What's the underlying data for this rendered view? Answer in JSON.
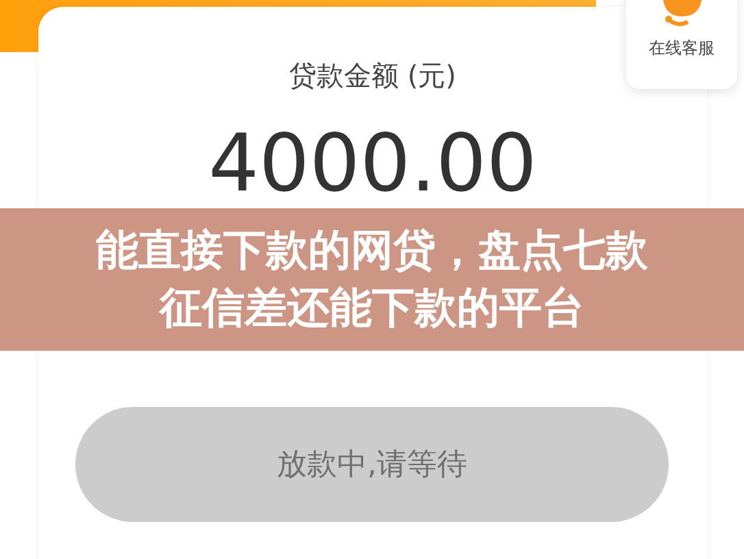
{
  "loan": {
    "label": "贷款金额 (元)",
    "amount": "4000.00"
  },
  "support": {
    "label": "在线客服"
  },
  "button": {
    "label": "放款中,请等待",
    "disabled": true
  },
  "banner": {
    "lines": [
      "能直接下款的网贷，盘点七款",
      "征信差还能下款的平台"
    ]
  }
}
